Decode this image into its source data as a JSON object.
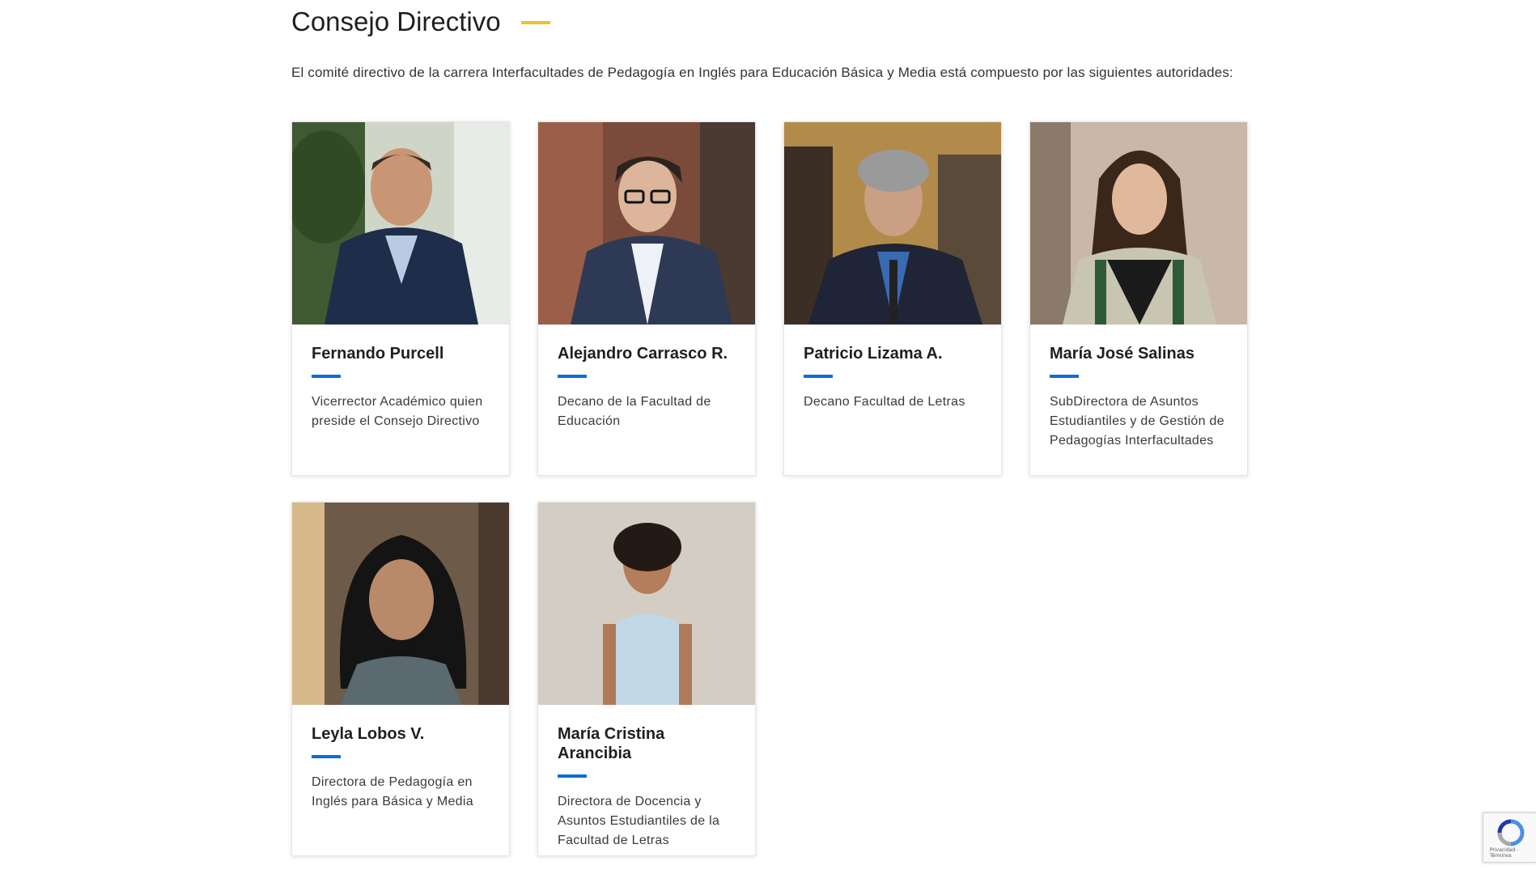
{
  "section": {
    "title": "Consejo Directivo",
    "intro": "El comité directivo de la carrera Interfacultades de Pedagogía en Inglés para Educación Básica y Media está compuesto por las siguientes autoridades:"
  },
  "colors": {
    "title_accent": "#f4c01e",
    "name_accent": "#0a6fd6"
  },
  "members": [
    {
      "name": "Fernando Purcell",
      "role": "Vicerrector Académico quien preside el Consejo Directivo",
      "photo": "portrait-photo"
    },
    {
      "name": "Alejandro Carrasco R.",
      "role": "Decano de la Facultad de Educación",
      "photo": "portrait-photo"
    },
    {
      "name": "Patricio Lizama A.",
      "role": "Decano Facultad de Letras",
      "photo": "portrait-photo"
    },
    {
      "name": "María José Salinas",
      "role": "SubDirectora de Asuntos Estudiantiles y de Gestión de Pedagogías Interfacultades",
      "photo": "portrait-photo"
    },
    {
      "name": "Leyla Lobos V.",
      "role": "Directora de Pedagogía en Inglés para Básica y Media",
      "photo": "portrait-photo"
    },
    {
      "name": "María Cristina Arancibia",
      "role": "Directora de Docencia y Asuntos Estudiantiles de la Facultad de Letras",
      "photo": "portrait-photo"
    }
  ],
  "recaptcha": {
    "terms": "Privacidad - Términos",
    "icon": "recaptcha-icon"
  }
}
